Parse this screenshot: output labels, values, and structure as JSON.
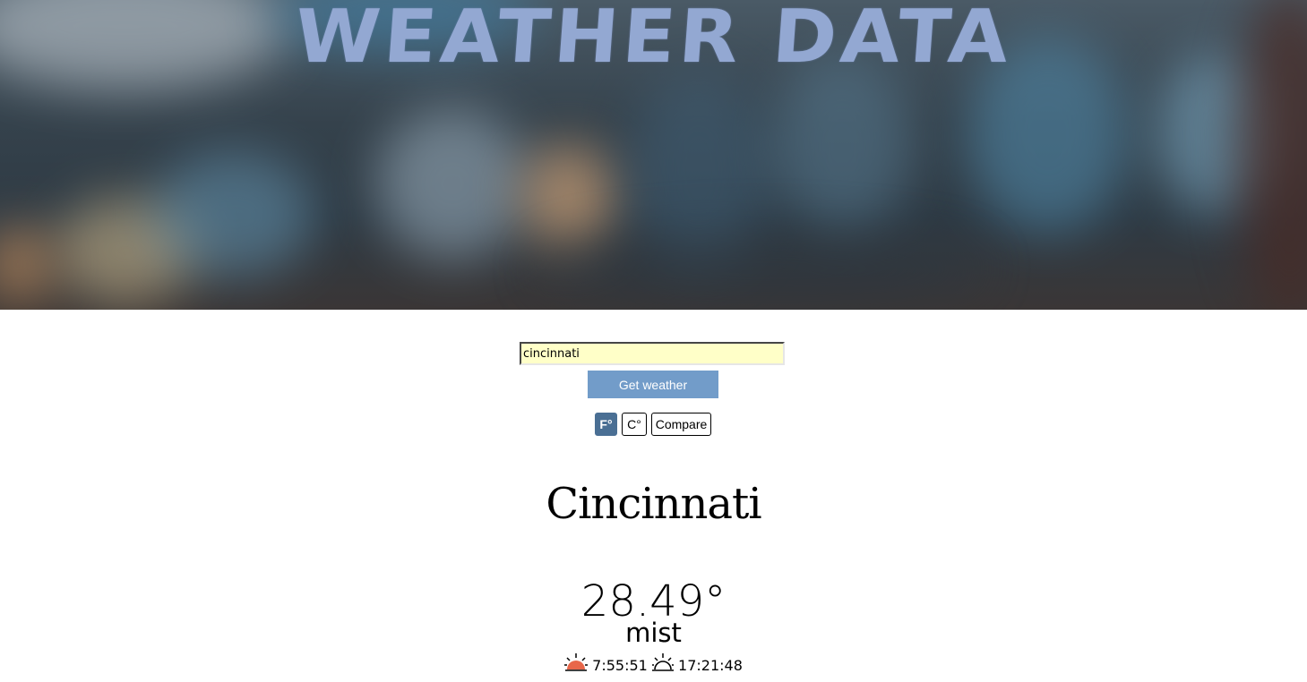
{
  "header": {
    "title": "WEATHER DATA"
  },
  "search": {
    "value": "cincinnati"
  },
  "actions": {
    "get_weather_label": "Get weather"
  },
  "units": {
    "fahrenheit_label": "F°",
    "celsius_label": "C°",
    "compare_label": "Compare",
    "active": "fahrenheit"
  },
  "weather": {
    "city": "Cincinnati",
    "temperature": "28.49°",
    "description": "mist",
    "sunrise": "7:55:51",
    "sunset": "17:21:48"
  },
  "icons": {
    "sunrise": "sunrise-icon",
    "sunset": "sunset-icon"
  },
  "colors": {
    "title": "#93a8d2",
    "button": "#729cc9",
    "active_unit": "#4a6f94",
    "input_bg": "#ffffc8",
    "sunrise": "#e8674a"
  }
}
